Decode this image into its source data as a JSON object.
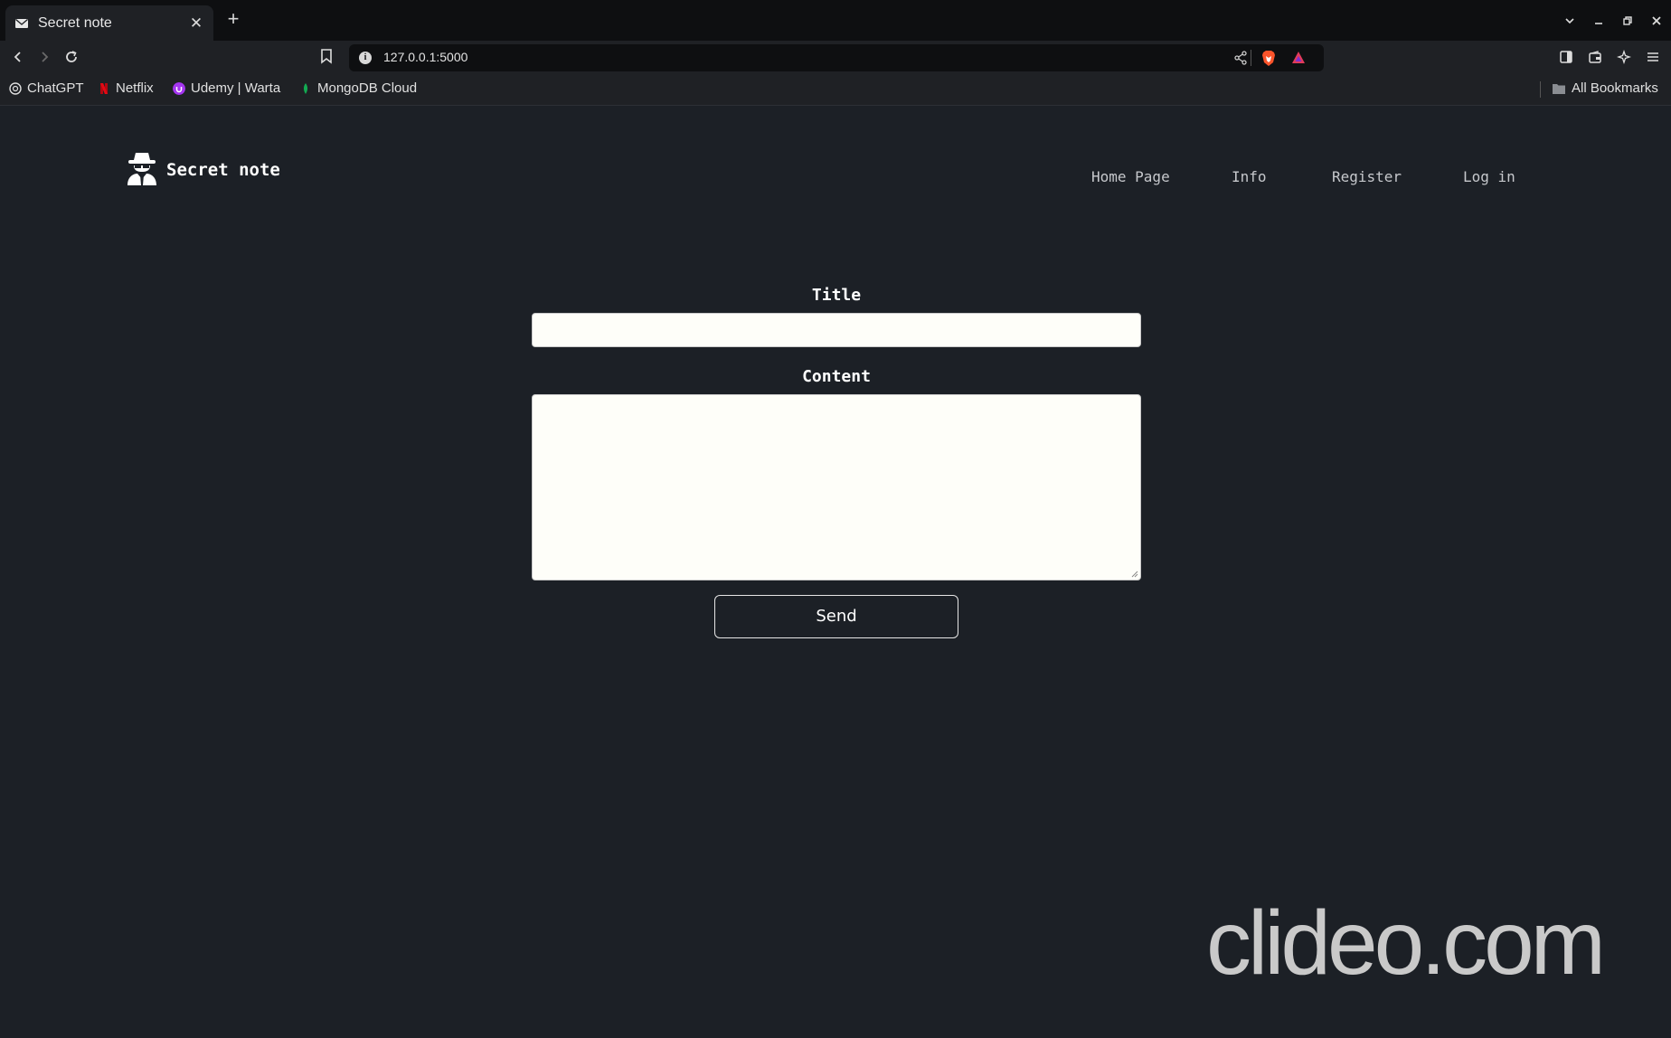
{
  "browser": {
    "tab": {
      "title": "Secret note",
      "icon": "envelope-icon"
    },
    "address": {
      "url": "127.0.0.1:5000"
    },
    "bookmarks": [
      {
        "label": "ChatGPT",
        "icon": "chatgpt-icon",
        "color": "#e0e0e0"
      },
      {
        "label": "Netflix",
        "icon": "netflix-icon",
        "color": "#e50914"
      },
      {
        "label": "Udemy | Warta",
        "icon": "udemy-icon",
        "color": "#a435f0"
      },
      {
        "label": "MongoDB Cloud",
        "icon": "mongodb-icon",
        "color": "#13aa52"
      }
    ],
    "all_bookmarks": "All Bookmarks"
  },
  "site": {
    "brand": "Secret note",
    "nav": [
      "Home Page",
      "Info",
      "Register",
      "Log in"
    ]
  },
  "form": {
    "title_label": "Title",
    "title_value": "",
    "content_label": "Content",
    "content_value": "",
    "send_label": "Send"
  },
  "watermark": "clideo.com"
}
